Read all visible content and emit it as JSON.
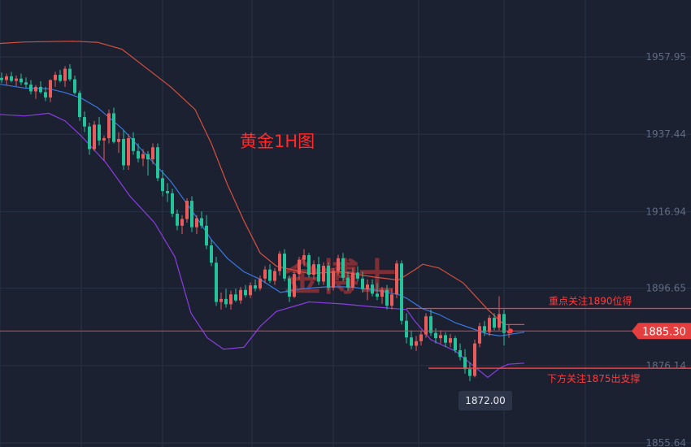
{
  "chart_data": {
    "type": "candlestick",
    "title": "黄金1H图",
    "watermark": "金博士",
    "ylim": [
      1855.64,
      1964.0
    ],
    "y_ticks": [
      "1957.95",
      "1937.44",
      "1916.94",
      "1896.65",
      "1876.14",
      "1855.64"
    ],
    "current_price": "1885.30",
    "low_marker": "1872.00",
    "levels": [
      {
        "label": "重点关注1890位得",
        "value": 1890
      },
      {
        "label": "下方关注1875出支撑",
        "value": 1875
      }
    ],
    "colors": {
      "up": "#e85c5c",
      "down": "#26c29a",
      "upper_band": "#d6503f",
      "middle_band": "#3a78e0",
      "lower_band": "#8a3de0",
      "level_line": "#ff3b3b",
      "current_line": "#d94a4a",
      "title": "#ff2a2a"
    },
    "bands": {
      "upper": [
        [
          0,
          1961.5
        ],
        [
          30,
          1961.9
        ],
        [
          60,
          1962.0
        ],
        [
          90,
          1962.1
        ],
        [
          120,
          1961.8
        ],
        [
          150,
          1960.0
        ],
        [
          180,
          1955.0
        ],
        [
          210,
          1950.0
        ],
        [
          240,
          1944.0
        ],
        [
          260,
          1935.0
        ],
        [
          280,
          1924.0
        ],
        [
          300,
          1914.5
        ],
        [
          320,
          1906.0
        ],
        [
          340,
          1902.5
        ],
        [
          380,
          1900.5
        ],
        [
          420,
          1901.0
        ],
        [
          460,
          1899.6
        ],
        [
          490,
          1898.8
        ],
        [
          510,
          1901.5
        ],
        [
          520,
          1903.0
        ],
        [
          540,
          1902.0
        ],
        [
          570,
          1898.0
        ],
        [
          600,
          1891.0
        ],
        [
          620,
          1887.0
        ],
        [
          645,
          1887.0
        ]
      ],
      "middle": [
        [
          0,
          1950.7
        ],
        [
          30,
          1949.7
        ],
        [
          60,
          1949.5
        ],
        [
          80,
          1948.5
        ],
        [
          100,
          1947.0
        ],
        [
          120,
          1944.5
        ],
        [
          150,
          1939.0
        ],
        [
          180,
          1932.0
        ],
        [
          210,
          1925.0
        ],
        [
          240,
          1916.0
        ],
        [
          260,
          1909.5
        ],
        [
          280,
          1904.5
        ],
        [
          300,
          1901.0
        ],
        [
          320,
          1899.0
        ],
        [
          345,
          1895.5
        ],
        [
          370,
          1896.5
        ],
        [
          400,
          1897.0
        ],
        [
          430,
          1897.0
        ],
        [
          460,
          1896.2
        ],
        [
          490,
          1895.0
        ],
        [
          500,
          1894.0
        ],
        [
          520,
          1891.2
        ],
        [
          540,
          1889.7
        ],
        [
          560,
          1887.5
        ],
        [
          580,
          1886.0
        ],
        [
          600,
          1884.5
        ],
        [
          615,
          1884.0
        ],
        [
          645,
          1885.0
        ]
      ],
      "lower": [
        [
          0,
          1942.7
        ],
        [
          30,
          1942.3
        ],
        [
          60,
          1943.0
        ],
        [
          80,
          1941.0
        ],
        [
          100,
          1937.0
        ],
        [
          130,
          1930.0
        ],
        [
          160,
          1921.0
        ],
        [
          190,
          1914.0
        ],
        [
          215,
          1905.0
        ],
        [
          235,
          1890.0
        ],
        [
          255,
          1883.5
        ],
        [
          275,
          1880.5
        ],
        [
          300,
          1881.0
        ],
        [
          320,
          1886.5
        ],
        [
          340,
          1890.5
        ],
        [
          380,
          1893.0
        ],
        [
          420,
          1892.5
        ],
        [
          460,
          1891.7
        ],
        [
          500,
          1891.0
        ],
        [
          510,
          1888.0
        ],
        [
          530,
          1883.0
        ],
        [
          560,
          1880.0
        ],
        [
          580,
          1876.5
        ],
        [
          600,
          1873.0
        ],
        [
          615,
          1875.5
        ],
        [
          625,
          1876.5
        ],
        [
          645,
          1876.8
        ]
      ]
    },
    "candles": [
      [
        1952.4,
        1953.8,
        1951.0,
        1951.8
      ],
      [
        1951.8,
        1953.5,
        1950.5,
        1952.8
      ],
      [
        1952.8,
        1954.0,
        1951.2,
        1951.6
      ],
      [
        1951.6,
        1953.0,
        1950.2,
        1952.2
      ],
      [
        1952.2,
        1953.5,
        1950.5,
        1951.2
      ],
      [
        1951.2,
        1952.5,
        1949.6,
        1950.6
      ],
      [
        1950.6,
        1951.8,
        1948.0,
        1948.8
      ],
      [
        1948.8,
        1950.5,
        1946.8,
        1950.0
      ],
      [
        1950.0,
        1951.5,
        1948.2,
        1948.6
      ],
      [
        1948.6,
        1950.0,
        1946.2,
        1947.2
      ],
      [
        1947.2,
        1952.0,
        1946.0,
        1951.8
      ],
      [
        1951.8,
        1954.0,
        1950.0,
        1953.2
      ],
      [
        1953.2,
        1954.5,
        1951.2,
        1951.6
      ],
      [
        1951.6,
        1955.5,
        1950.0,
        1954.8
      ],
      [
        1954.8,
        1956.0,
        1951.5,
        1952.0
      ],
      [
        1952.0,
        1953.0,
        1948.0,
        1948.4
      ],
      [
        1948.4,
        1949.0,
        1941.0,
        1942.0
      ],
      [
        1942.0,
        1943.5,
        1938.0,
        1939.5
      ],
      [
        1939.5,
        1940.5,
        1932.0,
        1933.5
      ],
      [
        1933.5,
        1941.0,
        1933.0,
        1940.0
      ],
      [
        1940.0,
        1942.0,
        1934.5,
        1935.8
      ],
      [
        1935.8,
        1937.0,
        1930.5,
        1936.4
      ],
      [
        1936.4,
        1944.0,
        1935.0,
        1943.0
      ],
      [
        1943.0,
        1944.5,
        1935.0,
        1935.4
      ],
      [
        1935.4,
        1938.0,
        1932.5,
        1936.2
      ],
      [
        1936.2,
        1938.5,
        1928.0,
        1929.2
      ],
      [
        1929.2,
        1937.5,
        1928.0,
        1936.4
      ],
      [
        1936.4,
        1938.0,
        1932.0,
        1933.0
      ],
      [
        1933.0,
        1935.0,
        1930.0,
        1931.0
      ],
      [
        1931.0,
        1933.5,
        1929.0,
        1932.2
      ],
      [
        1932.2,
        1933.0,
        1926.5,
        1930.8
      ],
      [
        1930.8,
        1935.0,
        1929.5,
        1934.0
      ],
      [
        1934.0,
        1935.0,
        1925.0,
        1925.8
      ],
      [
        1925.8,
        1928.0,
        1921.0,
        1922.4
      ],
      [
        1922.4,
        1924.5,
        1919.5,
        1921.8
      ],
      [
        1921.8,
        1923.0,
        1915.5,
        1916.4
      ],
      [
        1916.4,
        1917.5,
        1912.0,
        1913.2
      ],
      [
        1913.2,
        1916.0,
        1911.0,
        1915.0
      ],
      [
        1915.0,
        1920.5,
        1914.0,
        1919.8
      ],
      [
        1919.8,
        1921.0,
        1911.5,
        1912.8
      ],
      [
        1912.8,
        1916.0,
        1911.0,
        1915.2
      ],
      [
        1915.2,
        1917.0,
        1912.5,
        1913.2
      ],
      [
        1913.2,
        1916.0,
        1907.0,
        1908.0
      ],
      [
        1908.0,
        1909.5,
        1902.5,
        1903.4
      ],
      [
        1903.4,
        1905.0,
        1892.0,
        1893.0
      ],
      [
        1893.0,
        1895.5,
        1891.0,
        1893.8
      ],
      [
        1893.8,
        1896.5,
        1891.5,
        1892.4
      ],
      [
        1892.4,
        1896.0,
        1891.0,
        1895.0
      ],
      [
        1895.0,
        1896.5,
        1893.0,
        1893.4
      ],
      [
        1893.4,
        1897.0,
        1892.5,
        1896.2
      ],
      [
        1896.2,
        1897.5,
        1894.2,
        1894.8
      ],
      [
        1894.8,
        1898.2,
        1894.0,
        1897.4
      ],
      [
        1897.4,
        1899.0,
        1895.8,
        1896.6
      ],
      [
        1896.6,
        1900.0,
        1896.0,
        1899.2
      ],
      [
        1899.2,
        1902.5,
        1898.0,
        1901.6
      ],
      [
        1901.6,
        1903.0,
        1898.0,
        1898.6
      ],
      [
        1898.6,
        1902.0,
        1897.5,
        1901.2
      ],
      [
        1901.2,
        1906.5,
        1900.0,
        1905.8
      ],
      [
        1905.8,
        1907.0,
        1898.5,
        1899.2
      ],
      [
        1899.2,
        1900.0,
        1893.0,
        1894.4
      ],
      [
        1894.4,
        1901.0,
        1894.0,
        1900.4
      ],
      [
        1900.4,
        1905.0,
        1899.0,
        1904.2
      ],
      [
        1904.2,
        1907.0,
        1902.5,
        1905.4
      ],
      [
        1905.4,
        1906.0,
        1899.5,
        1900.2
      ],
      [
        1900.2,
        1904.0,
        1899.0,
        1903.0
      ],
      [
        1903.0,
        1905.0,
        1897.5,
        1898.4
      ],
      [
        1898.4,
        1903.5,
        1897.5,
        1902.6
      ],
      [
        1902.6,
        1903.5,
        1896.0,
        1896.8
      ],
      [
        1896.8,
        1902.0,
        1896.0,
        1901.2
      ],
      [
        1901.2,
        1905.5,
        1900.0,
        1904.6
      ],
      [
        1904.6,
        1906.0,
        1898.5,
        1899.4
      ],
      [
        1899.4,
        1901.0,
        1896.0,
        1896.8
      ],
      [
        1896.8,
        1902.0,
        1896.0,
        1900.8
      ],
      [
        1900.8,
        1902.5,
        1898.5,
        1899.2
      ],
      [
        1899.2,
        1901.0,
        1895.5,
        1896.4
      ],
      [
        1896.4,
        1899.0,
        1893.5,
        1897.6
      ],
      [
        1897.6,
        1899.0,
        1894.5,
        1895.2
      ],
      [
        1895.2,
        1898.0,
        1893.5,
        1894.4
      ],
      [
        1894.4,
        1897.0,
        1892.5,
        1896.2
      ],
      [
        1896.2,
        1897.5,
        1891.0,
        1892.0
      ],
      [
        1892.0,
        1896.5,
        1891.0,
        1895.0
      ],
      [
        1895.0,
        1904.0,
        1894.0,
        1903.2
      ],
      [
        1903.2,
        1904.0,
        1887.0,
        1888.0
      ],
      [
        1888.0,
        1890.0,
        1882.0,
        1883.6
      ],
      [
        1883.6,
        1885.5,
        1880.5,
        1881.4
      ],
      [
        1881.4,
        1884.0,
        1880.0,
        1882.6
      ],
      [
        1882.6,
        1885.5,
        1881.5,
        1884.4
      ],
      [
        1884.4,
        1890.0,
        1883.5,
        1889.2
      ],
      [
        1889.2,
        1891.0,
        1884.0,
        1884.8
      ],
      [
        1884.8,
        1886.0,
        1882.0,
        1883.4
      ],
      [
        1883.4,
        1885.5,
        1882.0,
        1884.2
      ],
      [
        1884.2,
        1885.0,
        1881.0,
        1882.2
      ],
      [
        1882.2,
        1884.5,
        1881.0,
        1883.4
      ],
      [
        1883.4,
        1884.0,
        1879.5,
        1880.2
      ],
      [
        1880.2,
        1882.0,
        1877.5,
        1878.4
      ],
      [
        1878.4,
        1880.5,
        1874.0,
        1875.2
      ],
      [
        1875.2,
        1877.0,
        1872.0,
        1873.4
      ],
      [
        1873.4,
        1883.0,
        1873.0,
        1882.0
      ],
      [
        1882.0,
        1887.5,
        1881.0,
        1886.6
      ],
      [
        1886.6,
        1888.0,
        1884.0,
        1885.0
      ],
      [
        1885.0,
        1889.5,
        1884.0,
        1888.8
      ],
      [
        1888.8,
        1890.0,
        1885.5,
        1886.2
      ],
      [
        1886.2,
        1894.5,
        1885.5,
        1889.8
      ],
      [
        1889.8,
        1891.0,
        1881.5,
        1884.8
      ],
      [
        1884.8,
        1887.0,
        1883.5,
        1885.3
      ]
    ]
  }
}
